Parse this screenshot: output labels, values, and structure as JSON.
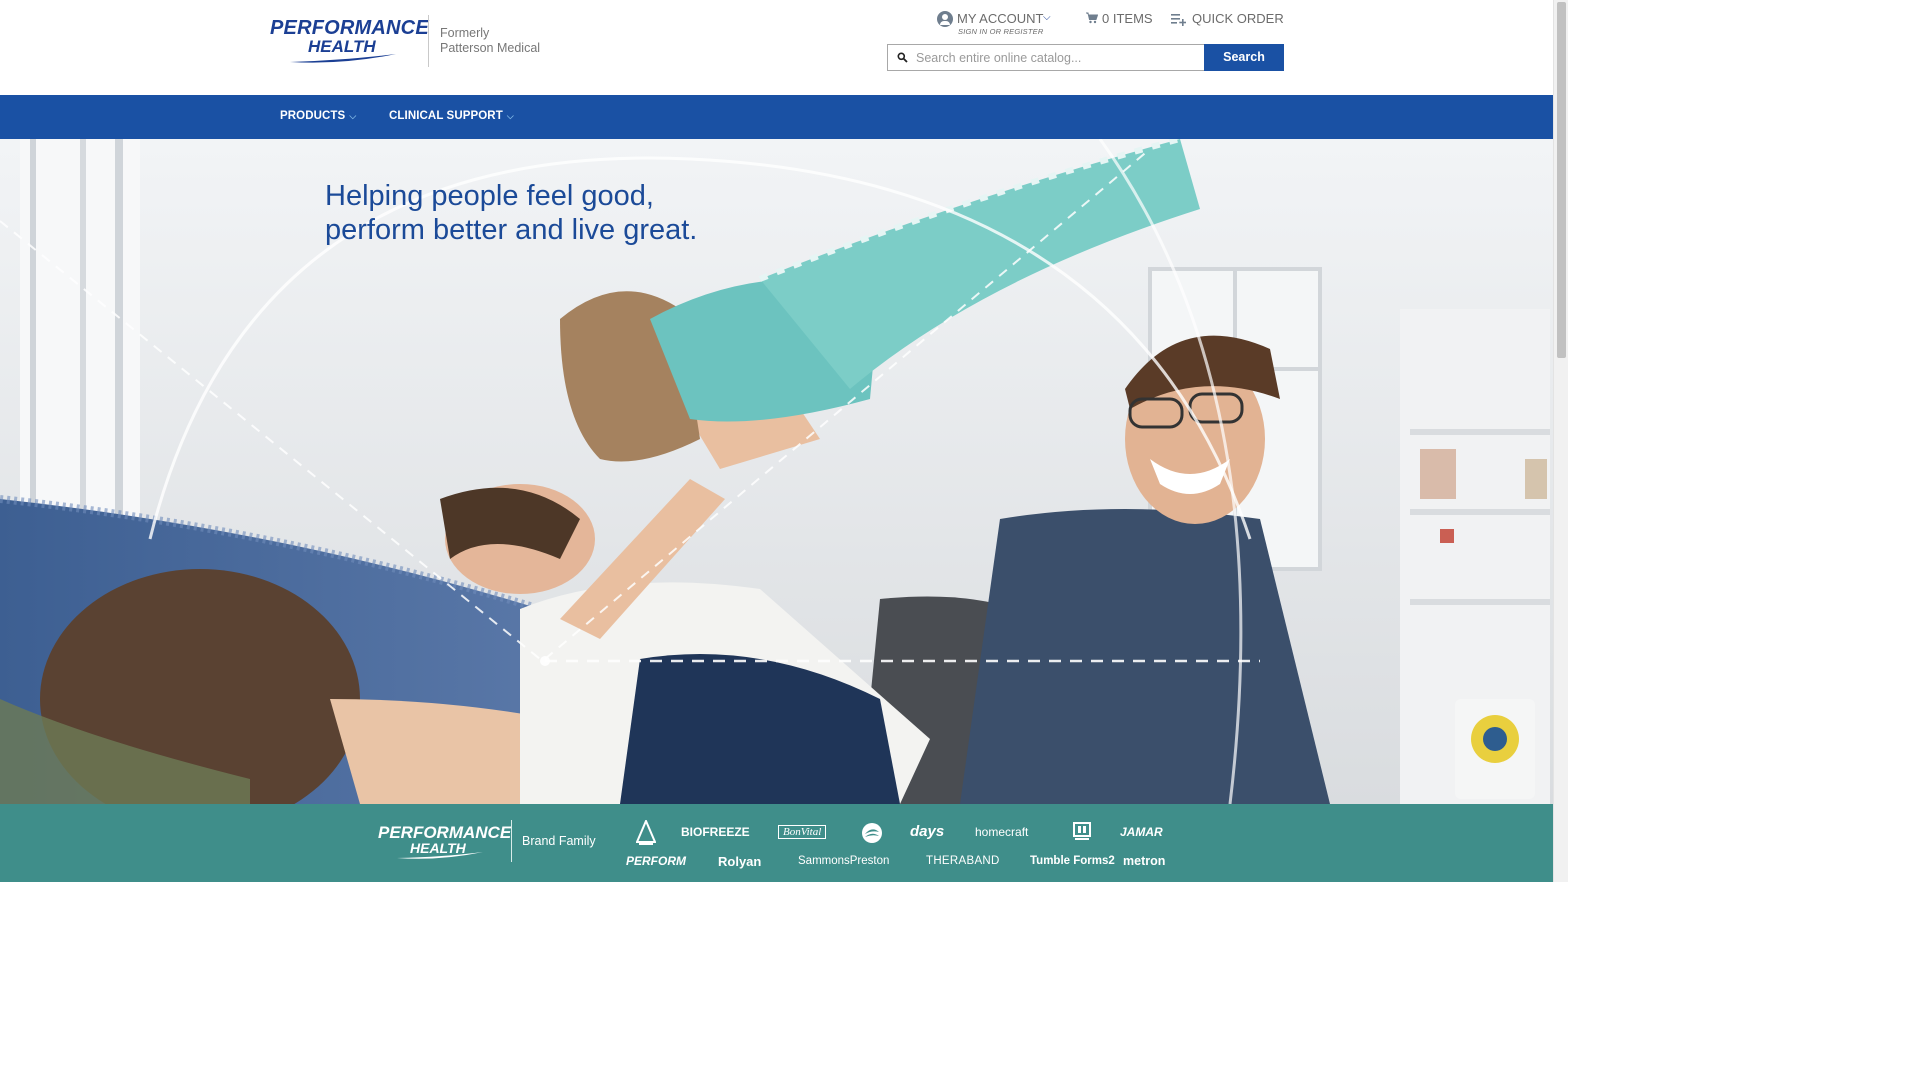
{
  "header": {
    "logo_line1": "PERFORMANCE",
    "logo_line2": "HEALTH",
    "formerly_line1": "Formerly",
    "formerly_line2": "Patterson Medical",
    "account_label": "MY ACCOUNT",
    "account_sub": "SIGN IN OR REGISTER",
    "cart_label": "0 ITEMS",
    "quick_order_label": "QUICK ORDER",
    "search_placeholder": "Search entire online catalog...",
    "search_button": "Search"
  },
  "nav": {
    "items": [
      {
        "label": "PRODUCTS"
      },
      {
        "label": "CLINICAL SUPPORT"
      }
    ]
  },
  "hero": {
    "headline_line1": "Helping people feel good,",
    "headline_line2": "perform better and live great."
  },
  "brand_bar": {
    "logo_line1": "PERFORMANCE",
    "logo_line2": "HEALTH",
    "family_label": "Brand Family",
    "brands_row1": [
      "BIOFREEZE",
      "BonVital",
      "days",
      "homecraft",
      "JAMAR"
    ],
    "brands_row2": [
      "PERFORM",
      "Rolyan",
      "SammonsPreston",
      "THERABAND",
      "Tumble Forms2",
      "metron"
    ]
  },
  "colors": {
    "brand_blue": "#1a51a4",
    "logo_navy": "#1b3f94",
    "teal_bar": "#3f8e8a",
    "headline_blue": "#1b4a98"
  }
}
